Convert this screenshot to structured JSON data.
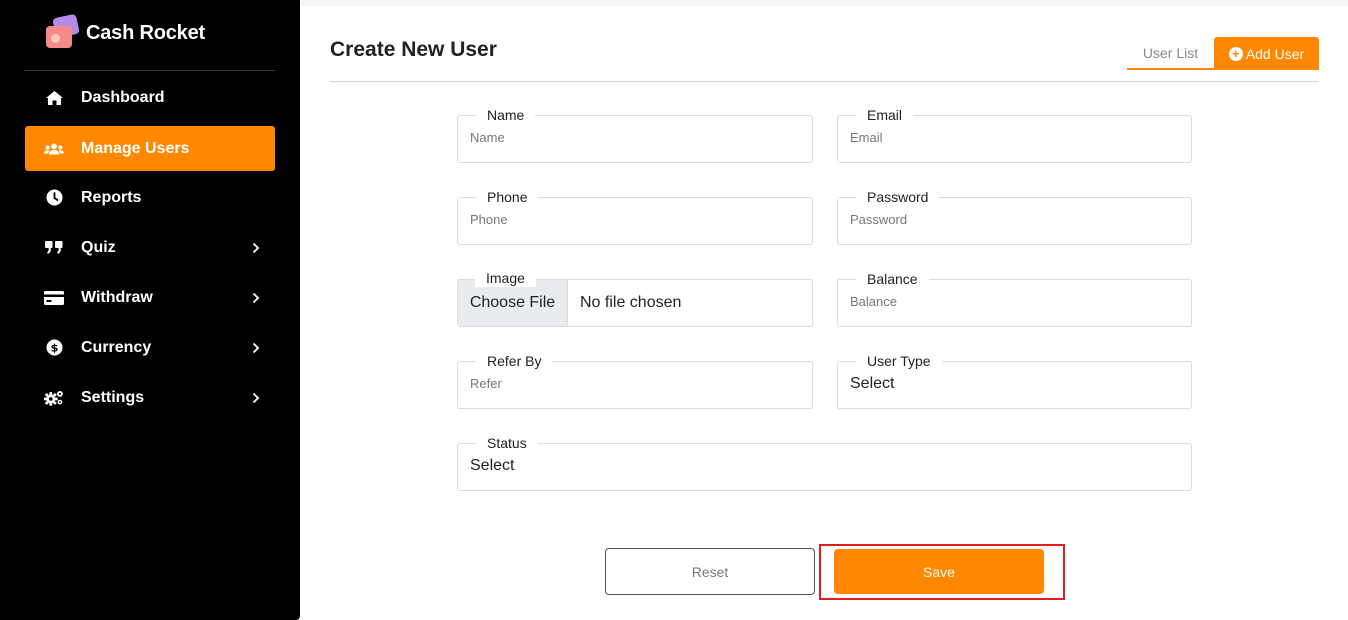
{
  "brand": {
    "name": "Cash Rocket"
  },
  "sidebar": {
    "items": [
      {
        "label": "Dashboard",
        "icon": "home-icon",
        "active": false,
        "has_submenu": false
      },
      {
        "label": "Manage Users",
        "icon": "users-icon",
        "active": true,
        "has_submenu": false
      },
      {
        "label": "Reports",
        "icon": "clock-icon",
        "active": false,
        "has_submenu": false
      },
      {
        "label": "Quiz",
        "icon": "quote-icon",
        "active": false,
        "has_submenu": true
      },
      {
        "label": "Withdraw",
        "icon": "credit-card-icon",
        "active": false,
        "has_submenu": true
      },
      {
        "label": "Currency",
        "icon": "dollar-icon",
        "active": false,
        "has_submenu": true
      },
      {
        "label": "Settings",
        "icon": "gears-icon",
        "active": false,
        "has_submenu": true
      }
    ]
  },
  "header": {
    "title": "Create New User",
    "tabs": {
      "user_list": "User List",
      "add_user": "Add User"
    }
  },
  "form": {
    "name": {
      "label": "Name",
      "placeholder": "Name"
    },
    "email": {
      "label": "Email",
      "placeholder": "Email"
    },
    "phone": {
      "label": "Phone",
      "placeholder": "Phone"
    },
    "password": {
      "label": "Password",
      "placeholder": "Password"
    },
    "image": {
      "label": "Image",
      "button": "Choose File",
      "status": "No file chosen"
    },
    "balance": {
      "label": "Balance",
      "placeholder": "Balance"
    },
    "refer_by": {
      "label": "Refer By",
      "placeholder": "Refer"
    },
    "user_type": {
      "label": "User Type",
      "value": "Select"
    },
    "status": {
      "label": "Status",
      "value": "Select"
    }
  },
  "actions": {
    "reset": "Reset",
    "save": "Save"
  },
  "colors": {
    "accent": "#ff8800",
    "sidebar_bg": "#000000",
    "highlight": "#e11d1d"
  }
}
